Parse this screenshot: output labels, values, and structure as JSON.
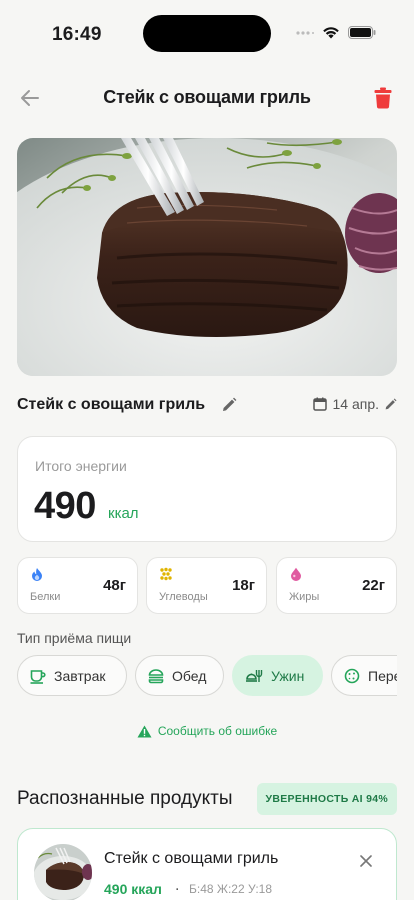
{
  "status_bar": {
    "time": "16:49"
  },
  "nav": {
    "title": "Стейк с овощами гриль"
  },
  "meal": {
    "name": "Стейк с овощами гриль",
    "date": "14 апр."
  },
  "energy": {
    "label": "Итого энергии",
    "value": "490",
    "unit": "ккал"
  },
  "macros": [
    {
      "label": "Белки",
      "value": "48г",
      "icon": "flame-icon",
      "color": "#3b82f6"
    },
    {
      "label": "Углеводы",
      "value": "18г",
      "icon": "grain-icon",
      "color": "#e0b400"
    },
    {
      "label": "Жиры",
      "value": "22г",
      "icon": "drop-icon",
      "color": "#e05aa0"
    }
  ],
  "meal_type": {
    "title": "Тип приёма пищи",
    "options": [
      {
        "label": "Завтрак",
        "icon": "cup-icon"
      },
      {
        "label": "Обед",
        "icon": "burger-icon"
      },
      {
        "label": "Ужин",
        "icon": "dinner-icon",
        "selected": true
      },
      {
        "label": "Пере",
        "icon": "cookie-icon"
      }
    ]
  },
  "report": {
    "label": "Сообщить об ошибке"
  },
  "recognized": {
    "title": "Распознанные продукты",
    "confidence": "УВЕРЕННОСТЬ AI 94%",
    "items": [
      {
        "name": "Стейк с овощами гриль",
        "kcal": "490 ккал",
        "macros": "Б:48 Ж:22 У:18"
      }
    ]
  },
  "colors": {
    "accent": "#25a55a",
    "accent_light": "#d6f3e1",
    "danger": "#ef3b3b",
    "background": "#f6f6f4"
  }
}
